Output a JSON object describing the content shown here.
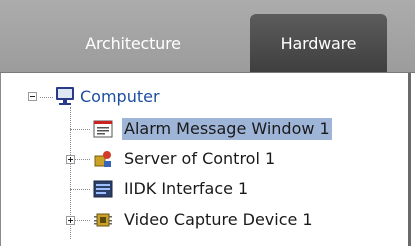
{
  "tabs": [
    {
      "label": "Architecture",
      "active": false
    },
    {
      "label": "Hardware",
      "active": true
    }
  ],
  "tree": {
    "root": {
      "label": "Computer",
      "icon": "computer-monitor-icon",
      "expanded": true
    },
    "children": [
      {
        "label": "Alarm Message Window 1",
        "icon": "message-window-icon",
        "has_children": false,
        "selected": true
      },
      {
        "label": "Server of Control 1",
        "icon": "server-control-icon",
        "has_children": true,
        "selected": false
      },
      {
        "label": "IIDK Interface 1",
        "icon": "iidk-interface-icon",
        "has_children": false,
        "selected": false
      },
      {
        "label": "Video Capture Device 1",
        "icon": "video-capture-chip-icon",
        "has_children": true,
        "selected": false
      }
    ]
  },
  "colors": {
    "tab_bar": "#a8a8a8",
    "active_tab": "#4a4a4a",
    "selection": "#9fb5d8",
    "root_text": "#1c4fa0"
  }
}
